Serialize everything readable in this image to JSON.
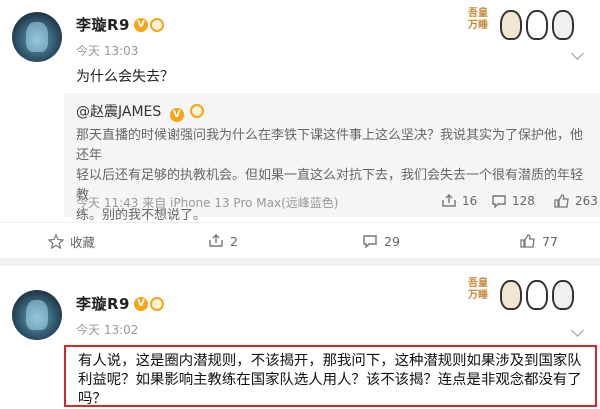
{
  "post1": {
    "username": "李璇R9",
    "verified_badge": "V",
    "time": "今天 13:03",
    "text": "为什么会失去？",
    "repost": {
      "author": "@赵震JAMES",
      "author_badge": "V",
      "lines": [
        "那天直播的时候谢强问我为什么在李铁下课这件事上这么坚决？我说其实为了保护他，他还年",
        "轻以后还有足够的执教机会。但如果一直这么对抗下去，我们会失去一个很有潜质的年轻教",
        "练。别的我不想说了。"
      ],
      "meta": "今天 11:43 来自 iPhone 13 Pro Max(远峰蓝色)",
      "reposts": "16",
      "comments": "128",
      "likes": "263"
    },
    "actions": {
      "favorite_label": "收藏",
      "reposts": "2",
      "comments": "29",
      "likes": "77"
    }
  },
  "post2": {
    "username": "李璇R9",
    "verified_badge": "V",
    "time": "今天 13:02",
    "lines": [
      "有人说，这是圈内潜规则，不该揭开，那我问下，这种潜规则如果涉及到国家队",
      "利益呢？如果影响主教练在国家队选人用人？该不该揭？连点是非观念都没有了",
      "吗？"
    ]
  },
  "sticker": {
    "text": "吾皇万睡"
  },
  "colors": {
    "accent_red": "#d22a2a",
    "badge_orange": "#f7a417",
    "meta_gray": "#999999"
  }
}
